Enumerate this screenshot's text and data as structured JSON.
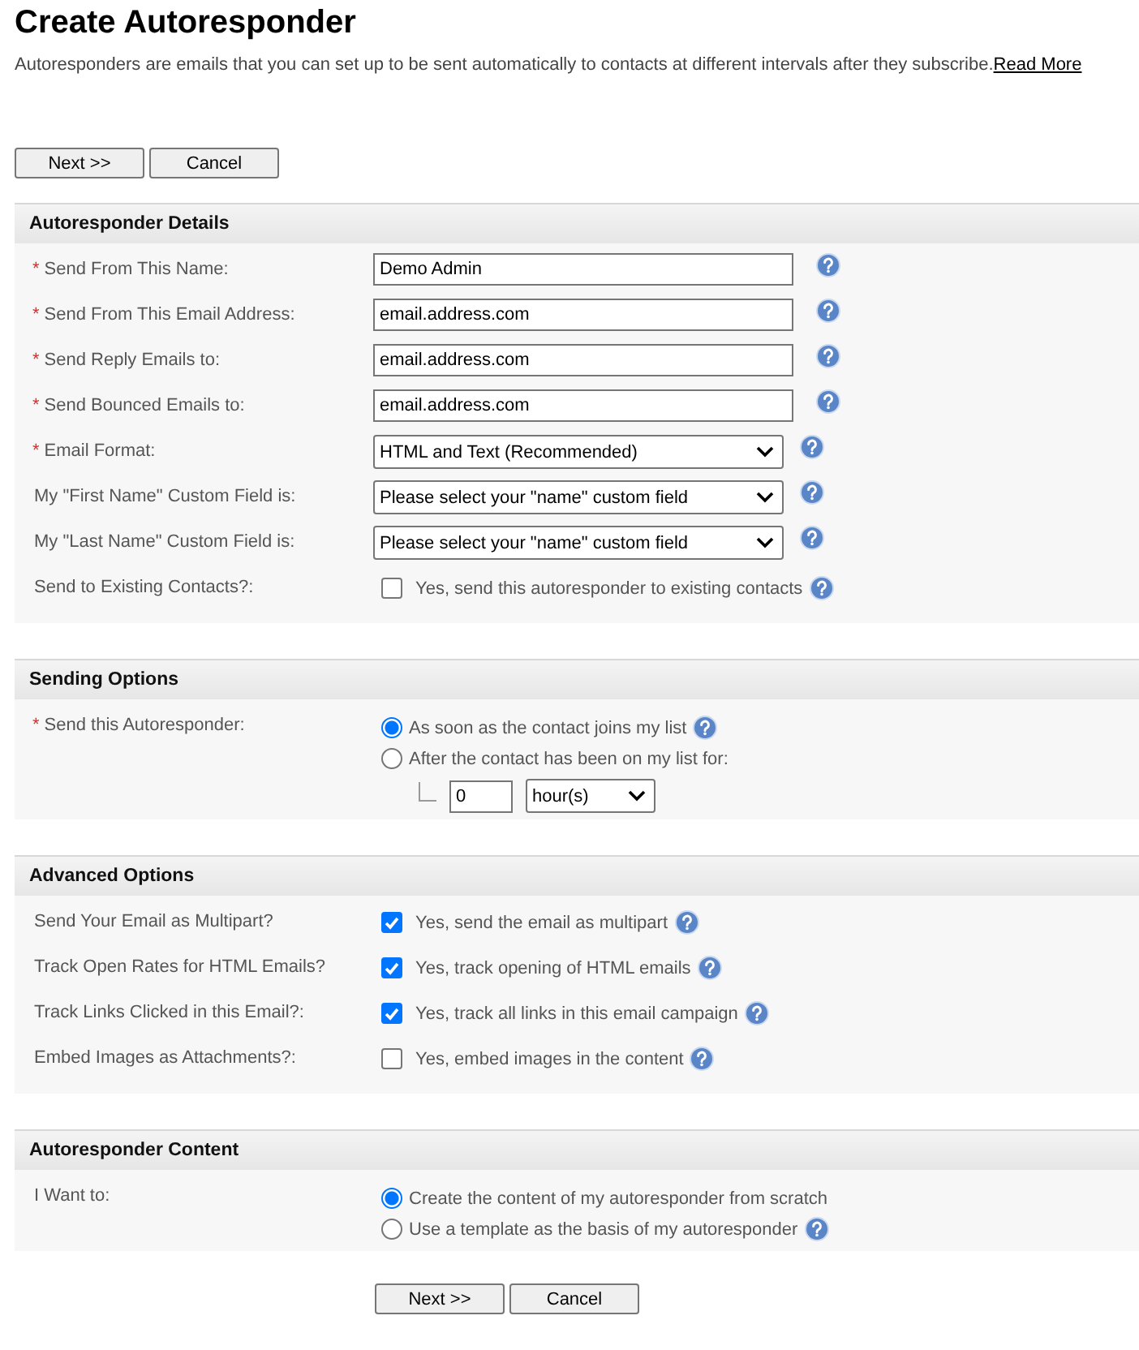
{
  "title": "Create Autoresponder",
  "description": {
    "text": "Autoresponders are emails that you can set up to be sent automatically to contacts at different intervals after they subscribe.",
    "link": "Read More"
  },
  "top_buttons": [
    "Next >>",
    "Cancel"
  ],
  "sections": [
    {
      "title": "Autoresponder Details",
      "rows": [
        {
          "kind": "text",
          "label": "Send From This Name:",
          "required_mark": "*",
          "value": "Demo Admin",
          "help": true
        },
        {
          "kind": "text",
          "label": "Send From This Email Address:",
          "required_mark": "*",
          "value": "email.address.com",
          "help": true
        },
        {
          "kind": "text",
          "label": "Send Reply Emails to:",
          "required_mark": "*",
          "value": "email.address.com",
          "help": true
        },
        {
          "kind": "text",
          "label": "Send Bounced Emails to:",
          "required_mark": "*",
          "value": "email.address.com",
          "help": true
        },
        {
          "kind": "select",
          "label": "Email Format:",
          "required_mark": "*",
          "value": "HTML and Text (Recommended)",
          "help": true
        },
        {
          "kind": "select",
          "label": "My \"First Name\" Custom Field is:",
          "value": "Please select your \"name\" custom field",
          "help": true
        },
        {
          "kind": "select",
          "label": "My \"Last Name\" Custom Field is:",
          "value": "Please select your \"name\" custom field",
          "help": true
        },
        {
          "kind": "checkbox",
          "label": "Send to Existing Contacts?:",
          "option": "Yes, send this autoresponder to existing contacts",
          "checked": false,
          "help": true
        }
      ]
    },
    {
      "title": "Sending Options",
      "rows": [
        {
          "kind": "radio",
          "label": "Send this Autoresponder:",
          "required_mark": "*",
          "options": [
            {
              "label": "As soon as the contact joins my list",
              "selected": true,
              "help": true
            },
            {
              "label": "After the contact has been on my list for:",
              "selected": false,
              "help": false,
              "delay": {
                "value": "0",
                "unit": "hour(s)"
              }
            }
          ]
        }
      ]
    },
    {
      "title": "Advanced Options",
      "rows": [
        {
          "kind": "checkbox",
          "label": "Send Your Email as Multipart?",
          "option": "Yes, send the email as multipart",
          "checked": true,
          "help": true
        },
        {
          "kind": "checkbox",
          "label": "Track Open Rates for HTML Emails?",
          "option": "Yes, track opening of HTML emails",
          "checked": true,
          "help": true
        },
        {
          "kind": "checkbox",
          "label": "Track Links Clicked in this Email?:",
          "option": "Yes, track all links in this email campaign",
          "checked": true,
          "help": true
        },
        {
          "kind": "checkbox",
          "label": "Embed Images as Attachments?:",
          "option": "Yes, embed images in the content",
          "checked": false,
          "help": true
        }
      ]
    },
    {
      "title": "Autoresponder Content",
      "rows": [
        {
          "kind": "radio",
          "label": "I Want to:",
          "options": [
            {
              "label": "Create the content of my autoresponder from scratch",
              "selected": true,
              "help": false
            },
            {
              "label": "Use a template as the basis of my autoresponder",
              "selected": false,
              "help": true
            }
          ]
        }
      ]
    }
  ],
  "bottom_buttons": [
    "Next >>",
    "Cancel"
  ]
}
